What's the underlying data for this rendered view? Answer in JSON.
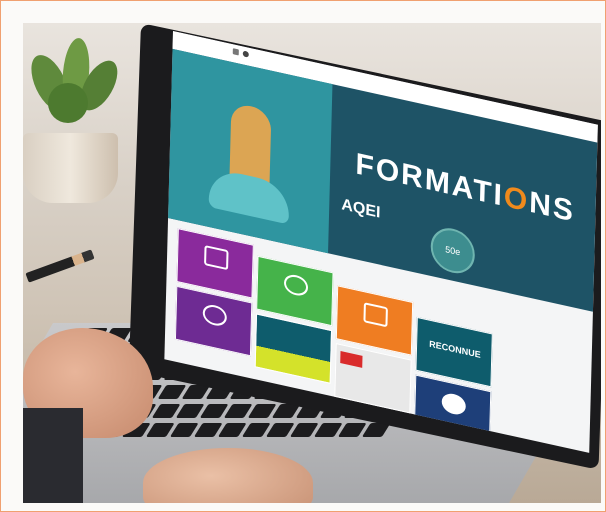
{
  "image": {
    "description_free": true
  },
  "screen": {
    "hero_title_main": "FORMATI",
    "hero_title_o": "O",
    "hero_title_end": "NS",
    "logo_text": "AQEI",
    "badge_text": "50e",
    "reconnue_text": "RECONNUE"
  },
  "colors": {
    "hero_dark": "#1e5366",
    "hero_teal": "#2f95a0",
    "accent_orange": "#f08a1c",
    "tile_purple": "#8a2a9c",
    "tile_green": "#45b34a",
    "tile_orange": "#ef7d22",
    "tile_navy": "#1e3f79",
    "tile_dark_teal": "#0e5c6c",
    "tile_lime": "#d4e22a"
  }
}
